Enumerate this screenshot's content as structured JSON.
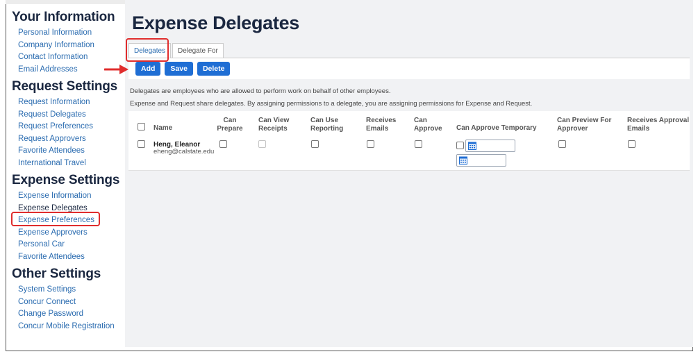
{
  "sidebar": {
    "your_information": {
      "title": "Your Information",
      "items": [
        "Personal Information",
        "Company Information",
        "Contact Information",
        "Email Addresses"
      ]
    },
    "request_settings": {
      "title": "Request Settings",
      "items": [
        "Request Information",
        "Request Delegates",
        "Request Preferences",
        "Request Approvers",
        "Favorite Attendees",
        "International Travel"
      ]
    },
    "expense_settings": {
      "title": "Expense Settings",
      "items": [
        "Expense Information",
        "Expense Delegates",
        "Expense Preferences",
        "Expense Approvers",
        "Personal Car",
        "Favorite Attendees"
      ]
    },
    "other_settings": {
      "title": "Other Settings",
      "items": [
        "System Settings",
        "Concur Connect",
        "Change Password",
        "Concur Mobile Registration"
      ]
    }
  },
  "main": {
    "title": "Expense Delegates",
    "tabs": [
      "Delegates",
      "Delegate For"
    ],
    "buttons": {
      "add": "Add",
      "save": "Save",
      "delete": "Delete"
    },
    "description_1": "Delegates are employees who are allowed to perform work on behalf of other employees.",
    "description_2": "Expense and Request share delegates. By assigning permissions to a delegate, you are assigning permissions for Expense and Request.",
    "table": {
      "headers": {
        "name": "Name",
        "can_prepare": [
          "Can",
          "Prepare"
        ],
        "can_view_receipts": [
          "Can View",
          "Receipts"
        ],
        "can_use_reporting": [
          "Can Use",
          "Reporting"
        ],
        "receives_emails": [
          "Receives",
          "Emails"
        ],
        "can_approve": [
          "Can",
          "Approve"
        ],
        "can_approve_temporary": "Can Approve Temporary",
        "can_preview_for_approver": [
          "Can Preview For",
          "Approver"
        ],
        "receives_approval_emails": [
          "Receives Approval",
          "Emails"
        ]
      },
      "rows": [
        {
          "name": "Heng, Eleanor",
          "email": "eheng@calstate.edu"
        }
      ]
    }
  },
  "colors": {
    "accent": "#1f6ed4",
    "link": "#2b6cb0",
    "heading": "#1a2740",
    "highlight": "#e02d2d"
  }
}
